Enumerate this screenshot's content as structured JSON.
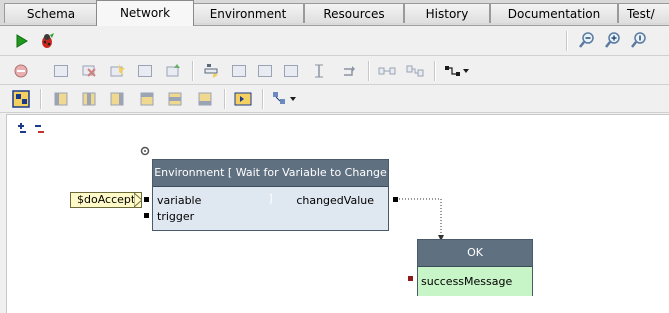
{
  "tabs": [
    {
      "label": "Schema",
      "active": false
    },
    {
      "label": "Network",
      "active": true
    },
    {
      "label": "Environment",
      "active": false
    },
    {
      "label": "Resources",
      "active": false
    },
    {
      "label": "History",
      "active": false
    },
    {
      "label": "Documentation",
      "active": false
    },
    {
      "label": "Test/",
      "active": false
    }
  ],
  "toolbar": {
    "run_icon": "play-icon",
    "debug_icon": "bug-icon",
    "zoom_icons": [
      "zoom-out-icon",
      "zoom-in-icon",
      "zoom-reset-icon"
    ]
  },
  "colors": {
    "node_header": "#5f7080",
    "node_body": "#dfe7f0",
    "ok_body": "#c8f5c8",
    "input_pill": "#fffac8",
    "success_port": "#8b1a1a"
  },
  "diagram": {
    "input_variable": "$doAccept",
    "env_node": {
      "title": "Environment [ Wait for Variable to Change ]",
      "inputs": [
        "variable",
        "trigger"
      ],
      "output": "changedValue"
    },
    "ok_node": {
      "title": "OK",
      "input": "successMessage"
    }
  }
}
